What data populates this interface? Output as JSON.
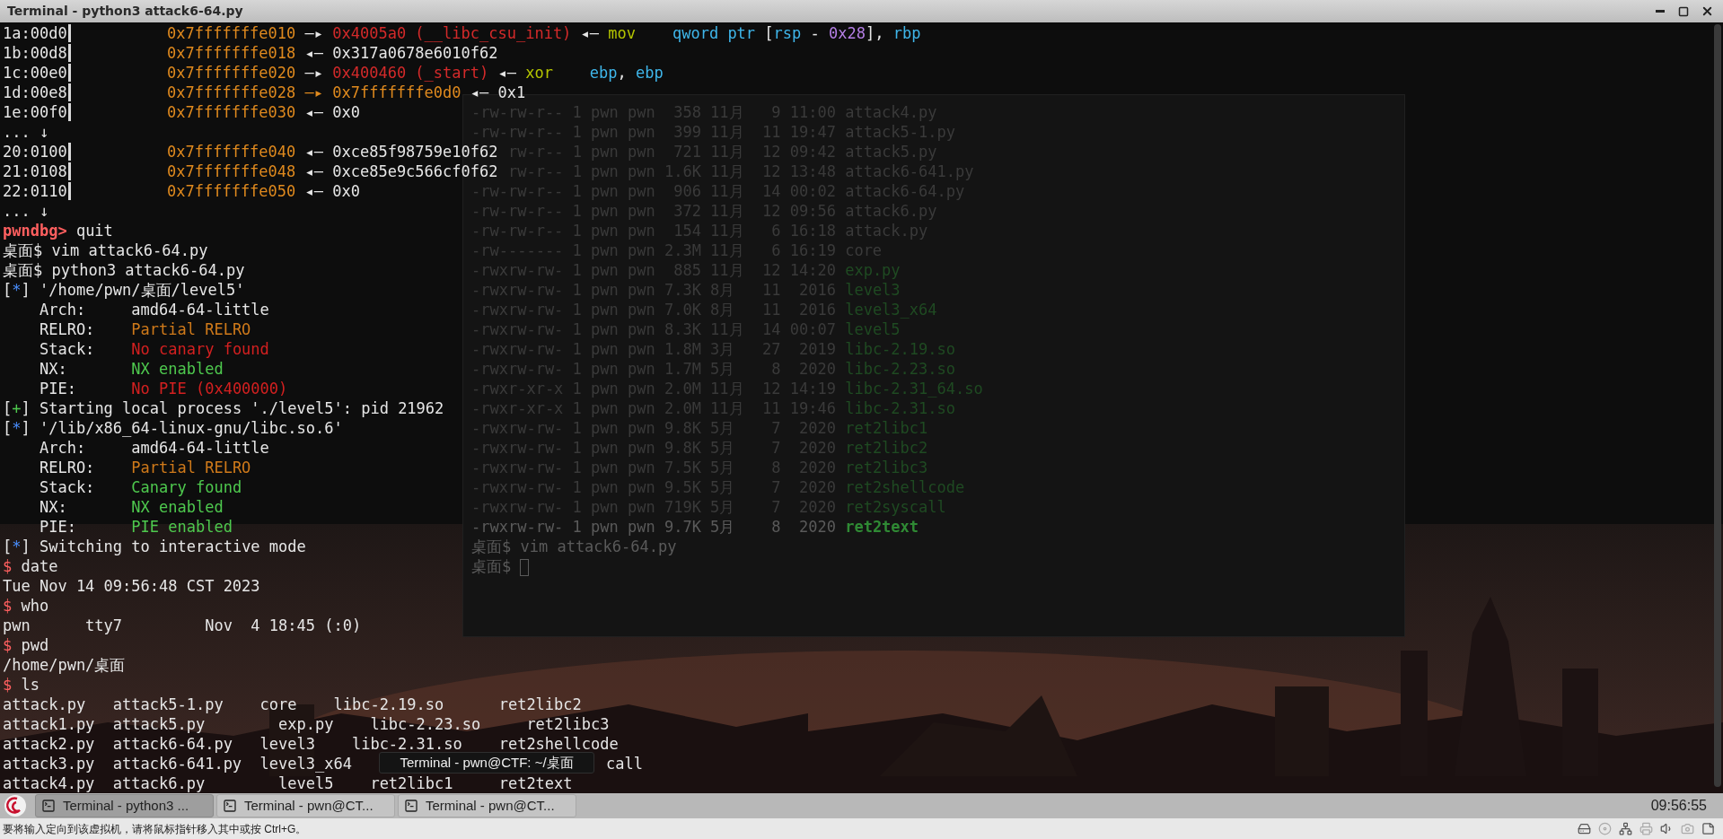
{
  "window": {
    "title": "Terminal - python3 attack6-64.py"
  },
  "terminal": {
    "lines": [
      {
        "segments": [
          {
            "text": "1a:00d0",
            "kind": "offset"
          },
          {
            "text": "0x7fffffffe010",
            "kind": "addr"
          },
          {
            "text": " —▸ ",
            "kind": "plain"
          },
          {
            "text": "0x4005a0 (__libc_csu_init)",
            "kind": "ptr"
          },
          {
            "text": " ◂— ",
            "kind": "plain"
          },
          {
            "text": "mov",
            "kind": "ins"
          },
          {
            "text": "    qword ptr",
            "kind": "op"
          },
          {
            "text": " [",
            "kind": "plain"
          },
          {
            "text": "rsp",
            "kind": "op"
          },
          {
            "text": " - ",
            "kind": "plain"
          },
          {
            "text": "0x28",
            "kind": "num"
          },
          {
            "text": "], ",
            "kind": "plain"
          },
          {
            "text": "rbp",
            "kind": "op"
          }
        ]
      },
      {
        "segments": [
          {
            "text": "1b:00d8",
            "kind": "offset"
          },
          {
            "text": "0x7fffffffe018",
            "kind": "addr"
          },
          {
            "text": " ◂— 0x317a0678e6010f62",
            "kind": "plain"
          }
        ]
      },
      {
        "segments": [
          {
            "text": "1c:00e0",
            "kind": "offset"
          },
          {
            "text": "0x7fffffffe020",
            "kind": "addr"
          },
          {
            "text": " —▸ ",
            "kind": "plain"
          },
          {
            "text": "0x400460 (_start)",
            "kind": "ptr"
          },
          {
            "text": " ◂— ",
            "kind": "plain"
          },
          {
            "text": "xor",
            "kind": "ins"
          },
          {
            "text": "    ebp",
            "kind": "op"
          },
          {
            "text": ", ",
            "kind": "plain"
          },
          {
            "text": "ebp",
            "kind": "op"
          }
        ]
      },
      {
        "segments": [
          {
            "text": "1d:00e8",
            "kind": "offset"
          },
          {
            "text": "0x7fffffffe028 —▸ 0x7fffffffe0d0",
            "kind": "addr"
          },
          {
            "text": " ◂— 0x1",
            "kind": "plain"
          }
        ]
      },
      {
        "segments": [
          {
            "text": "1e:00f0",
            "kind": "offset"
          },
          {
            "text": "0x7fffffffe030",
            "kind": "addr"
          },
          {
            "text": " ◂— 0x0",
            "kind": "plain"
          }
        ]
      },
      {
        "segments": [
          {
            "text": "... ↓",
            "kind": "plain"
          }
        ]
      },
      {
        "segments": [
          {
            "text": "20:0100",
            "kind": "offset"
          },
          {
            "text": "0x7fffffffe040",
            "kind": "addr"
          },
          {
            "text": " ◂— 0xce85f98759e10f62",
            "kind": "plain"
          }
        ]
      },
      {
        "segments": [
          {
            "text": "21:0108",
            "kind": "offset"
          },
          {
            "text": "0x7fffffffe048",
            "kind": "addr"
          },
          {
            "text": " ◂— 0xce85e9c566cf0f62",
            "kind": "plain"
          }
        ]
      },
      {
        "segments": [
          {
            "text": "22:0110",
            "kind": "offset"
          },
          {
            "text": "0x7fffffffe050",
            "kind": "addr"
          },
          {
            "text": " ◂— 0x0",
            "kind": "plain"
          }
        ]
      },
      {
        "segments": [
          {
            "text": "... ↓",
            "kind": "plain"
          }
        ]
      },
      {
        "segments": [
          {
            "text": "pwndbg>",
            "kind": "dbg"
          },
          {
            "text": " quit",
            "kind": "plain"
          }
        ]
      },
      {
        "segments": [
          {
            "text": "桌面$ vim attack6-64.py",
            "kind": "plain"
          }
        ]
      },
      {
        "segments": [
          {
            "text": "桌面$ python3 attack6-64.py",
            "kind": "plain"
          }
        ]
      },
      {
        "segments": [
          {
            "text": "[",
            "kind": "plain"
          },
          {
            "text": "*",
            "kind": "star"
          },
          {
            "text": "] '/home/pwn/桌面/level5'",
            "kind": "plain"
          }
        ]
      },
      {
        "segments": [
          {
            "text": "    Arch:     amd64-64-little",
            "kind": "plain"
          }
        ]
      },
      {
        "segments": [
          {
            "text": "    RELRO:    ",
            "kind": "plain"
          },
          {
            "text": "Partial RELRO",
            "kind": "warn"
          }
        ]
      },
      {
        "segments": [
          {
            "text": "    Stack:    ",
            "kind": "plain"
          },
          {
            "text": "No canary found",
            "kind": "bad"
          }
        ]
      },
      {
        "segments": [
          {
            "text": "    NX:       ",
            "kind": "plain"
          },
          {
            "text": "NX enabled",
            "kind": "good"
          }
        ]
      },
      {
        "segments": [
          {
            "text": "    PIE:      ",
            "kind": "plain"
          },
          {
            "text": "No PIE (0x400000)",
            "kind": "bad"
          }
        ]
      },
      {
        "segments": [
          {
            "text": "[",
            "kind": "plain"
          },
          {
            "text": "+",
            "kind": "good"
          },
          {
            "text": "] Starting local process './level5': pid 21962",
            "kind": "plain"
          }
        ]
      },
      {
        "segments": [
          {
            "text": "[",
            "kind": "plain"
          },
          {
            "text": "*",
            "kind": "star"
          },
          {
            "text": "] '/lib/x86_64-linux-gnu/libc.so.6'",
            "kind": "plain"
          }
        ]
      },
      {
        "segments": [
          {
            "text": "    Arch:     amd64-64-little",
            "kind": "plain"
          }
        ]
      },
      {
        "segments": [
          {
            "text": "    RELRO:    ",
            "kind": "plain"
          },
          {
            "text": "Partial RELRO",
            "kind": "warn"
          }
        ]
      },
      {
        "segments": [
          {
            "text": "    Stack:    ",
            "kind": "plain"
          },
          {
            "text": "Canary found",
            "kind": "good"
          }
        ]
      },
      {
        "segments": [
          {
            "text": "    NX:       ",
            "kind": "plain"
          },
          {
            "text": "NX enabled",
            "kind": "good"
          }
        ]
      },
      {
        "segments": [
          {
            "text": "    PIE:      ",
            "kind": "plain"
          },
          {
            "text": "PIE enabled",
            "kind": "good"
          }
        ]
      },
      {
        "segments": [
          {
            "text": "[",
            "kind": "plain"
          },
          {
            "text": "*",
            "kind": "star"
          },
          {
            "text": "] Switching to interactive mode",
            "kind": "plain"
          }
        ]
      },
      {
        "segments": [
          {
            "text": "$",
            "kind": "prompt"
          },
          {
            "text": " date",
            "kind": "plain"
          }
        ]
      },
      {
        "segments": [
          {
            "text": "Tue Nov 14 09:56:48 CST 2023",
            "kind": "plain"
          }
        ]
      },
      {
        "segments": [
          {
            "text": "$",
            "kind": "prompt"
          },
          {
            "text": " who",
            "kind": "plain"
          }
        ]
      },
      {
        "segments": [
          {
            "text": "pwn      tty7         Nov  4 18:45 (:0)",
            "kind": "plain"
          }
        ]
      },
      {
        "segments": [
          {
            "text": "$",
            "kind": "prompt"
          },
          {
            "text": " pwd",
            "kind": "plain"
          }
        ]
      },
      {
        "segments": [
          {
            "text": "/home/pwn/桌面",
            "kind": "plain"
          }
        ]
      },
      {
        "segments": [
          {
            "text": "$",
            "kind": "prompt"
          },
          {
            "text": " ls",
            "kind": "plain"
          }
        ]
      },
      {
        "segments": [
          {
            "text": "attack.py   attack5-1.py    core    libc-2.19.so      ret2libc2",
            "kind": "plain"
          }
        ]
      },
      {
        "segments": [
          {
            "text": "attack1.py  attack5.py        exp.py    libc-2.23.so     ret2libc3",
            "kind": "plain"
          }
        ]
      },
      {
        "segments": [
          {
            "text": "attack2.py  attack6-64.py   level3    libc-2.31.so    ret2shellcode",
            "kind": "plain"
          }
        ]
      },
      {
        "segments": [
          {
            "text": "attack3.py  attack6-641.py  level3_x64",
            "kind": "plain"
          },
          {
            "kind": "covered"
          },
          {
            "text": "call",
            "kind": "plain"
          }
        ]
      },
      {
        "segments": [
          {
            "text": "attack4.py  attack6.py        level5    ret2libc1     ret2text",
            "kind": "plain"
          }
        ]
      }
    ]
  },
  "tooltip": {
    "text": "Terminal - pwn@CTF: ~/桌面"
  },
  "background_terminal": {
    "lines": [
      {
        "segments": [
          {
            "text": "-rw-rw-r-- 1 pwn pwn  358 11月   9 11:00 attack4.py",
            "kind": "dim"
          }
        ]
      },
      {
        "segments": [
          {
            "text": "-rw-rw-r-- 1 pwn pwn  399 11月  11 19:47 attack5-1.py",
            "kind": "dim"
          }
        ]
      },
      {
        "segments": [
          {
            "kind": "gap"
          },
          {
            "text": "rw-r-- 1 pwn pwn  721 11月  12 09:42 attack5.py",
            "kind": "dim"
          }
        ]
      },
      {
        "segments": [
          {
            "kind": "gap"
          },
          {
            "text": "rw-r-- 1 pwn pwn 1.6K 11月  12 13:48 attack6-641.py",
            "kind": "dim"
          }
        ]
      },
      {
        "segments": [
          {
            "text": "-rw-rw-r-- 1 pwn pwn  906 11月  14 00:02 attack6-64.py",
            "kind": "dim"
          }
        ]
      },
      {
        "segments": [
          {
            "text": "-rw-rw-r-- 1 pwn pwn  372 11月  12 09:56 attack6.py",
            "kind": "dim"
          }
        ]
      },
      {
        "segments": [
          {
            "text": "-rw-rw-r-- 1 pwn pwn  154 11月   6 16:18 attack.py",
            "kind": "dim"
          }
        ]
      },
      {
        "segments": [
          {
            "text": "-rw------- 1 pwn pwn 2.3M 11月   6 16:19 core",
            "kind": "dim"
          }
        ]
      },
      {
        "segments": [
          {
            "text": "-rwxrw-rw- 1 pwn pwn  885 11月  12 14:20 ",
            "kind": "dim"
          },
          {
            "text": "exp.py",
            "kind": "dimexec"
          }
        ]
      },
      {
        "segments": [
          {
            "text": "-rwxrw-rw- 1 pwn pwn 7.3K 8月   11  2016 ",
            "kind": "dim"
          },
          {
            "text": "level3",
            "kind": "dimexec"
          }
        ]
      },
      {
        "segments": [
          {
            "text": "-rwxrw-rw- 1 pwn pwn 7.0K 8月   11  2016 ",
            "kind": "dim"
          },
          {
            "text": "level3_x64",
            "kind": "dimexec"
          }
        ]
      },
      {
        "segments": [
          {
            "text": "-rwxrw-rw- 1 pwn pwn 8.3K 11月  14 00:07 ",
            "kind": "dim"
          },
          {
            "text": "level5",
            "kind": "dimexec"
          }
        ]
      },
      {
        "segments": [
          {
            "text": "-rwxrw-rw- 1 pwn pwn 1.8M 3月   27  2019 ",
            "kind": "dim"
          },
          {
            "text": "libc-2.19.so",
            "kind": "dimexec"
          }
        ]
      },
      {
        "segments": [
          {
            "text": "-rwxrw-rw- 1 pwn pwn 1.7M 5月    8  2020 ",
            "kind": "dim"
          },
          {
            "text": "libc-2.23.so",
            "kind": "dimexec"
          }
        ]
      },
      {
        "segments": [
          {
            "text": "-rwxr-xr-x 1 pwn pwn 2.0M 11月  12 14:19 ",
            "kind": "dim"
          },
          {
            "text": "libc-2.31_64.so",
            "kind": "dimexec"
          }
        ]
      },
      {
        "segments": [
          {
            "text": "-rwxr-xr-x 1 pwn pwn 2.0M 11月  11 19:46 ",
            "kind": "dim"
          },
          {
            "text": "libc-2.31.so",
            "kind": "dimexec"
          }
        ]
      },
      {
        "segments": [
          {
            "text": "-rwxrw-rw- 1 pwn pwn 9.8K 5月    7  2020 ",
            "kind": "dim"
          },
          {
            "text": "ret2libc1",
            "kind": "dimexec"
          }
        ]
      },
      {
        "segments": [
          {
            "text": "-rwxrw-rw- 1 pwn pwn 9.8K 5月    7  2020 ",
            "kind": "dim"
          },
          {
            "text": "ret2libc2",
            "kind": "dimexec"
          }
        ]
      },
      {
        "segments": [
          {
            "text": "-rwxrw-rw- 1 pwn pwn 7.5K 5月    8  2020 ",
            "kind": "dim"
          },
          {
            "text": "ret2libc3",
            "kind": "dimexec"
          }
        ]
      },
      {
        "segments": [
          {
            "text": "-rwxrw-rw- 1 pwn pwn 9.5K 5月    7  2020 ",
            "kind": "dim"
          },
          {
            "text": "ret2shellcode",
            "kind": "dimexec"
          }
        ]
      },
      {
        "segments": [
          {
            "text": "-rwxrw-rw- 1 pwn pwn 719K 5月    7  2020 ",
            "kind": "dim"
          },
          {
            "text": "ret2syscall",
            "kind": "dimexec"
          }
        ]
      },
      {
        "segments": [
          {
            "text": "-rwxrw-rw- 1 pwn pwn 9.7K 5月    8  2020 ",
            "kind": "text"
          },
          {
            "text": "ret2text",
            "kind": "exec"
          }
        ]
      },
      {
        "segments": [
          {
            "text": "桌面$ vim attack6-64.py",
            "kind": "text"
          }
        ]
      },
      {
        "segments": [
          {
            "text": "桌面$ ",
            "kind": "text"
          },
          {
            "kind": "cursor"
          }
        ]
      }
    ]
  },
  "taskbar": {
    "buttons": [
      {
        "label": "Terminal - python3 ...",
        "selected": true
      },
      {
        "label": "Terminal - pwn@CT...",
        "selected": false
      },
      {
        "label": "Terminal - pwn@CT...",
        "selected": false
      }
    ],
    "clock": "09:56:55"
  },
  "status_bar": {
    "message": "要将输入定向到该虚拟机，请将鼠标指针移入其中或按 Ctrl+G。"
  }
}
